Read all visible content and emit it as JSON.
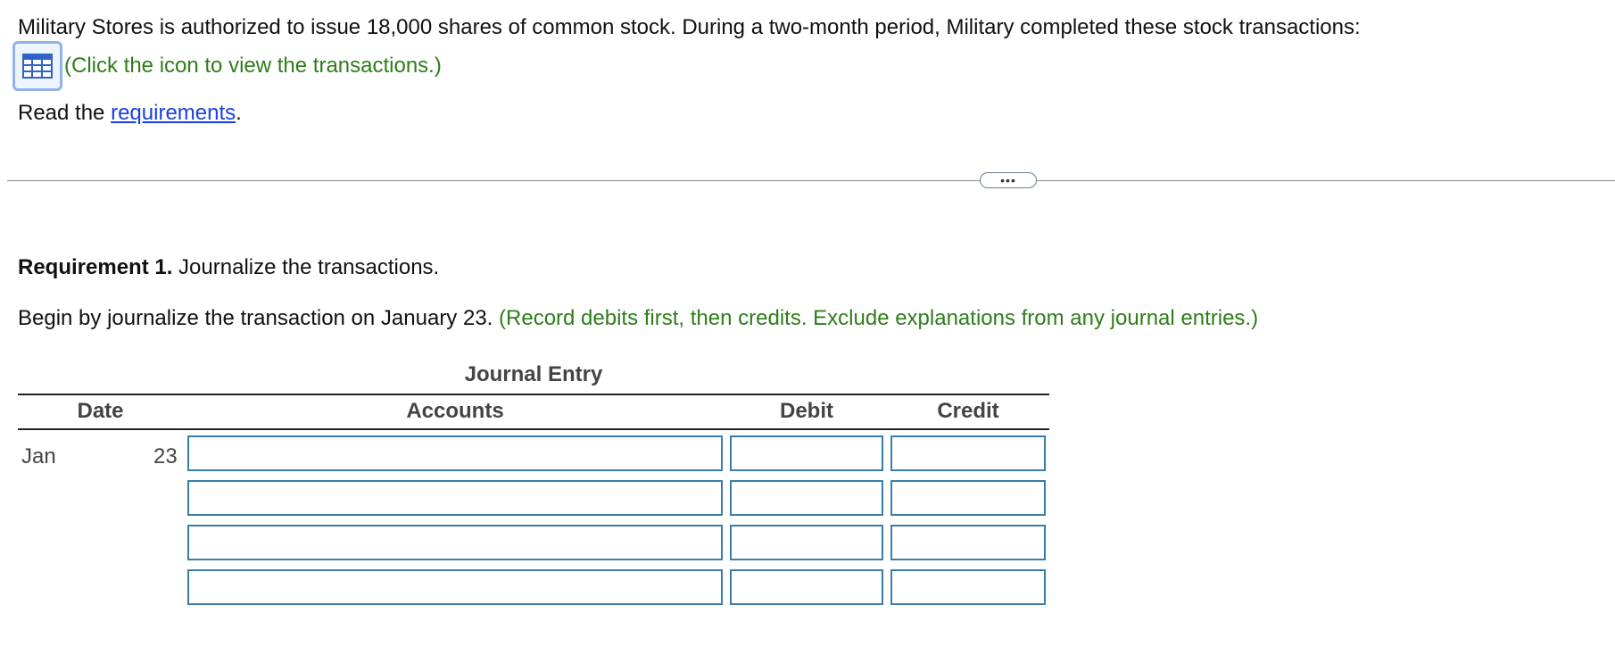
{
  "intro": {
    "text": "Military Stores is authorized to issue 18,000 shares of common stock. During a two-month period, Military completed these stock transactions:",
    "icon": "table-icon",
    "click_hint": "(Click the icon to view the transactions.)"
  },
  "read": {
    "prefix": "Read the ",
    "link": "requirements",
    "suffix": "."
  },
  "divider": {
    "more_label": "•••"
  },
  "requirement": {
    "label": "Requirement 1.",
    "text": " Journalize the transactions."
  },
  "instruction": {
    "text": "Begin by journalize the transaction on January 23. ",
    "hint": "(Record debits first, then credits. Exclude explanations from any journal entries.)"
  },
  "journal": {
    "title": "Journal Entry",
    "headers": {
      "date": "Date",
      "accounts": "Accounts",
      "debit": "Debit",
      "credit": "Credit"
    },
    "date": {
      "month": "Jan",
      "day": "23"
    },
    "rows": [
      {
        "account": "",
        "debit": "",
        "credit": ""
      },
      {
        "account": "",
        "debit": "",
        "credit": ""
      },
      {
        "account": "",
        "debit": "",
        "credit": ""
      },
      {
        "account": "",
        "debit": "",
        "credit": ""
      }
    ]
  },
  "colors": {
    "hint_green": "#2e7d1a",
    "link_blue": "#1a3fe0",
    "input_border": "#3a7ea8",
    "icon_border": "#8fb3e8"
  }
}
